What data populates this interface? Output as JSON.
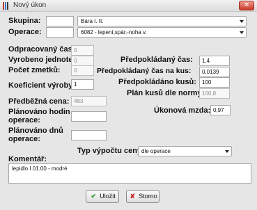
{
  "window": {
    "title": "Nový úkon",
    "close_glyph": "✕"
  },
  "skupina": {
    "label": "Skupina:",
    "code": "",
    "value": "Bára I. II."
  },
  "operace": {
    "label": "Operace:",
    "code": "",
    "value": "6082 - lepení,spár.-noha v."
  },
  "left": {
    "odpracovany_cas": {
      "label": "Odpracovaný čas:",
      "value": "0"
    },
    "vyrobeno": {
      "label": "Vyrobeno jednotek:",
      "value": "0"
    },
    "pocet_zmetku": {
      "label": "Počet zmetků:",
      "value": "0"
    },
    "koeficient": {
      "label": "Koeficient výroby:",
      "value": "1"
    },
    "predbezna_cena": {
      "label": "Předběžná cena:",
      "value": "483"
    },
    "planovano_hodin": {
      "label_line1": "Plánováno hodin",
      "label_line2": "operace:",
      "value": ""
    },
    "planovano_dnu": {
      "label_line1": "Plánováno dnů",
      "label_line2": "operace:",
      "value": ""
    }
  },
  "right": {
    "predpokladany_cas": {
      "label": "Předpokládaný čas:",
      "value": "1,4"
    },
    "predpokladany_cas_kus": {
      "label": "Předpokládaný čas na kus:",
      "value": "0,0139"
    },
    "predpokladano_kusu": {
      "label": "Předpokládáno kusů:",
      "value": "100"
    },
    "plan_kusu": {
      "label": "Plán kusů dle normy:",
      "value": "100,8"
    },
    "ukonova_mzda": {
      "label": "Úkonová mzda:",
      "value": "0,97"
    }
  },
  "typ_vypoctu": {
    "label": "Typ výpočtu ceny:",
    "value": "dle operace"
  },
  "komentar": {
    "label": "Komentář:",
    "value": "lepidlo I 01.00 - modré"
  },
  "buttons": {
    "save": "Uložit",
    "cancel": "Storno"
  },
  "icons": {
    "save": "check-icon",
    "cancel": "cross-icon",
    "app": "app-icon"
  },
  "colors": {
    "save_icon": "#2c9a2c",
    "cancel_icon": "#c42020",
    "close_button": "#c9392a"
  }
}
